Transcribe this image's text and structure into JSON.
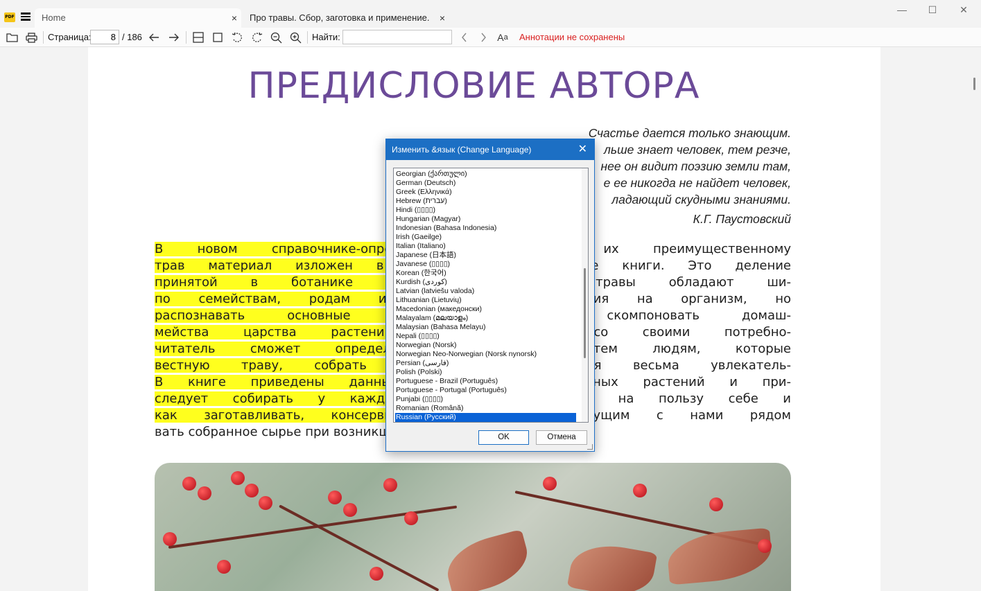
{
  "titlebar": {
    "app_logo": "PDF",
    "tabs": [
      {
        "label": "Home"
      },
      {
        "label": "Про травы. Сбор, заготовка и применение. Бо..."
      }
    ],
    "tab_close_glyph": "×",
    "window_controls": {
      "minimize": "—",
      "maximize": "☐",
      "close": "✕"
    }
  },
  "toolbar": {
    "page_label": "Страница:",
    "page_current": "8",
    "page_total": "/ 186",
    "find_label": "Найти:",
    "find_value": "",
    "annotation_status": "Аннотации не сохранены",
    "annotation_status_color": "#d92020",
    "icons": [
      "folder-open-icon",
      "print-icon",
      "arrow-left-icon",
      "arrow-right-icon",
      "single-page-icon",
      "fit-page-icon",
      "rotate-left-icon",
      "rotate-right-icon",
      "zoom-out-icon",
      "zoom-in-icon",
      "prev-match-icon",
      "next-match-icon",
      "match-case-icon"
    ]
  },
  "document": {
    "heading": "ПРЕДИСЛОВИЕ АВТОРА",
    "heading_color": "#6b4a98",
    "epigraph": [
      "Счастье дается только знающим.",
      "льше знает человек, тем резче,",
      "нее он видит поэзию земли там,",
      "е ее никогда не найдет человек,",
      "ладающий скудными знаниями."
    ],
    "epigraph_author": "К.Г. Паустовский",
    "highlight_color": "#ffff1e",
    "body_lines": [
      {
        "highlighted": "В новом справочнике-определителе",
        "rest": " трав по их преимущественному"
      },
      {
        "highlighted": "трав материал изложен в соответств",
        "rest": "ден в конце книги. Это деление"
      },
      {
        "highlighted": "принятой в ботанике классификаци",
        "rest": " многие травы обладают ши-"
      },
      {
        "highlighted": "по семействам, родам и видам. Н",
        "rest": " воздействия на организм, но"
      },
      {
        "highlighted": "распознавать основные признаки н",
        "rest": "поможет скомпоновать домаш-"
      },
      {
        "highlighted": "мейства царства растений, заинтер",
        "rest": "ответствии со своими потребно-"
      },
      {
        "highlighted": "читатель сможет определить найде",
        "rest": "адресован тем людям, которые"
      },
      {
        "highlighted": "вестную траву, собрать и заготовит",
        "rest": "ь заняться весьма увлекатель-"
      },
      {
        "highlighted": "В книге приведены данные о том, к",
        "rest": "лекарственных растений и при-"
      },
      {
        "highlighted": "следует собирать у каждого конкре",
        "rest": "силы природы на пользу себе и"
      },
      {
        "highlighted": "как заготавливать, консервиро",
        "rest": "вать                а также живущим с нами рядом"
      },
      {
        "highlighted": "",
        "rest": "вать собранное сырье при возникш                                            м»"
      }
    ]
  },
  "dialog": {
    "title": "Изменить &язык (Change Language)",
    "close_glyph": "✕",
    "languages": [
      "Georgian (ქართული)",
      "German (Deutsch)",
      "Greek (Ελληνικά)",
      "Hebrew (עברית)",
      "Hindi (▯▯▯▯)",
      "Hungarian (Magyar)",
      "Indonesian (Bahasa Indonesia)",
      "Irish (Gaeilge)",
      "Italian (Italiano)",
      "Japanese (日本語)",
      "Javanese (▯▯▯▯)",
      "Korean (한국어)",
      "Kurdish (کوردی)",
      "Latvian (latviešu valoda)",
      "Lithuanian (Lietuvių)",
      "Macedonian (македонски)",
      "Malayalam (മലയാളം)",
      "Malaysian (Bahasa Melayu)",
      "Nepali (▯▯▯▯)",
      "Norwegian (Norsk)",
      "Norwegian Neo-Norwegian (Norsk nynorsk)",
      "Persian (فارسی)",
      "Polish (Polski)",
      "Portuguese - Brazil (Português)",
      "Portuguese - Portugal (Português)",
      "Punjabi (▯▯▯▯)",
      "Romanian (Română)",
      "Russian (Русский)"
    ],
    "selected_language": "Russian (Русский)",
    "ok_label": "OK",
    "cancel_label": "Отмена"
  }
}
